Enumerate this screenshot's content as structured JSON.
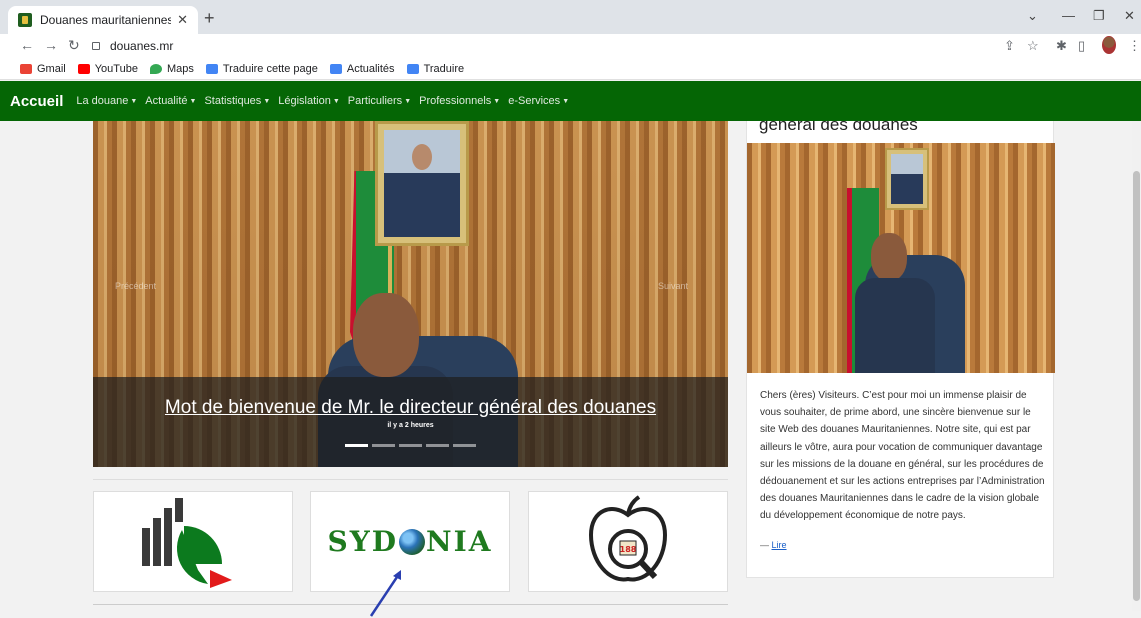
{
  "browser": {
    "tab_title": "Douanes mauritaniennes",
    "url": "douanes.mr",
    "bookmarks": [
      {
        "label": "Gmail",
        "icon": "gmail-icon",
        "color": "#ea4335"
      },
      {
        "label": "YouTube",
        "icon": "youtube-icon",
        "color": "#ff0000"
      },
      {
        "label": "Maps",
        "icon": "maps-icon",
        "color": "#34a853"
      },
      {
        "label": "Traduire cette page",
        "icon": "translate-icon",
        "color": "#4285f4"
      },
      {
        "label": "Actualités",
        "icon": "news-icon",
        "color": "#4285f4"
      },
      {
        "label": "Traduire",
        "icon": "translate-icon",
        "color": "#4285f4"
      }
    ]
  },
  "nav": {
    "brand": "Accueil",
    "items": [
      "La douane",
      "Actualité",
      "Statistiques",
      "Législation",
      "Particuliers",
      "Professionnels",
      "e-Services"
    ],
    "color": "#056605"
  },
  "carousel": {
    "prev": "Précédent",
    "next": "Suivant",
    "title": "Mot de bienvenue de Mr. le directeur général des douanes",
    "time": "il y a 2 heures",
    "slide_count": 5,
    "active_index": 0
  },
  "cards": [
    {
      "name": "statistics-card"
    },
    {
      "name": "sydonia-card",
      "text_before": "SYD",
      "text_after": "NIA"
    },
    {
      "name": "tariff-card",
      "badge": "188"
    }
  ],
  "sidebar": {
    "heading": "général des douanes",
    "body": "Chers (ères) Visiteurs. C’est pour moi un immense plaisir de vous souhaiter, de prime abord, une sincère bienvenue sur le site Web des douanes Mauritaniennes. Notre site, qui est par ailleurs le vôtre, aura pour vocation de communiquer davantage sur les missions de la douane en général, sur les procédures de dédouanement et sur les actions entreprises par l’Administration des douanes Mauritaniennes dans le cadre de la vision globale du développement économique de notre pays.",
    "read_more_dash": "—",
    "read_more": "Lire"
  }
}
